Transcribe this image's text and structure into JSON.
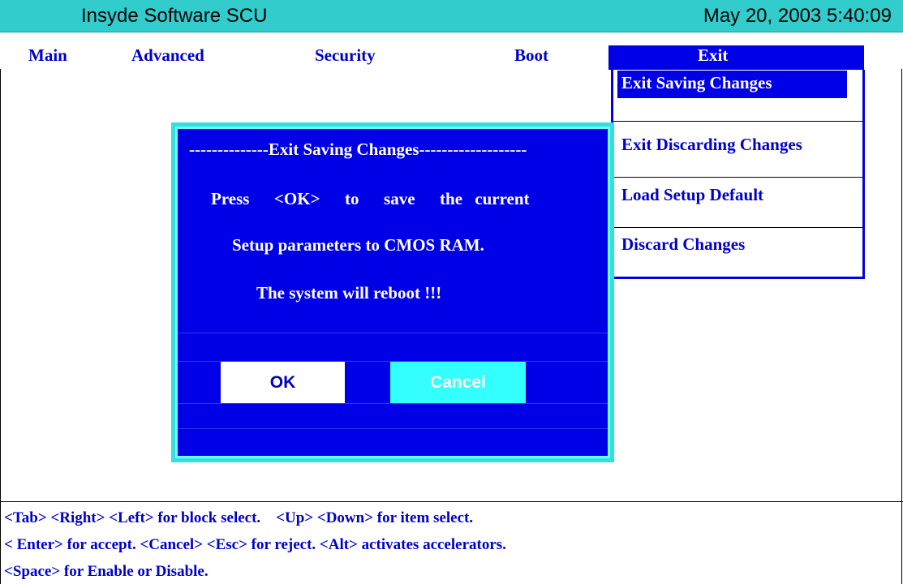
{
  "titlebar": {
    "app_title": "Insyde Software SCU",
    "datetime": "May 20, 2003 5:40:09"
  },
  "menu": {
    "tabs": [
      {
        "label": "Main"
      },
      {
        "label": "Advanced"
      },
      {
        "label": "Security"
      },
      {
        "label": "Boot"
      },
      {
        "label": "Exit"
      }
    ],
    "active_tab": "Exit"
  },
  "exit_menu": {
    "items": [
      {
        "label": "Exit Saving Changes",
        "selected": true
      },
      {
        "label": "Exit Discarding Changes",
        "selected": false
      },
      {
        "label": "Load Setup Default",
        "selected": false
      },
      {
        "label": "Discard Changes",
        "selected": false
      }
    ]
  },
  "dialog": {
    "title": "--------------Exit Saving Changes-------------------",
    "lines": [
      "Press  <OK>  to  save  the current",
      "Setup parameters to CMOS RAM.",
      "The system will reboot !!!"
    ],
    "ok_label": "OK",
    "cancel_label": "Cancel"
  },
  "help": {
    "lines": [
      "<Tab> <Right> <Left> for block select.    <Up> <Down> for item select.",
      "< Enter> for accept. <Cancel> <Esc> for reject. <Alt> activates accelerators.",
      "<Space> for Enable or Disable."
    ]
  },
  "colors": {
    "titlebar_bg": "#33cccc",
    "accent_blue": "#0000e6",
    "text_blue": "#0000cc",
    "dialog_border": "#33e0e0",
    "cancel_bg": "#33ffff"
  }
}
